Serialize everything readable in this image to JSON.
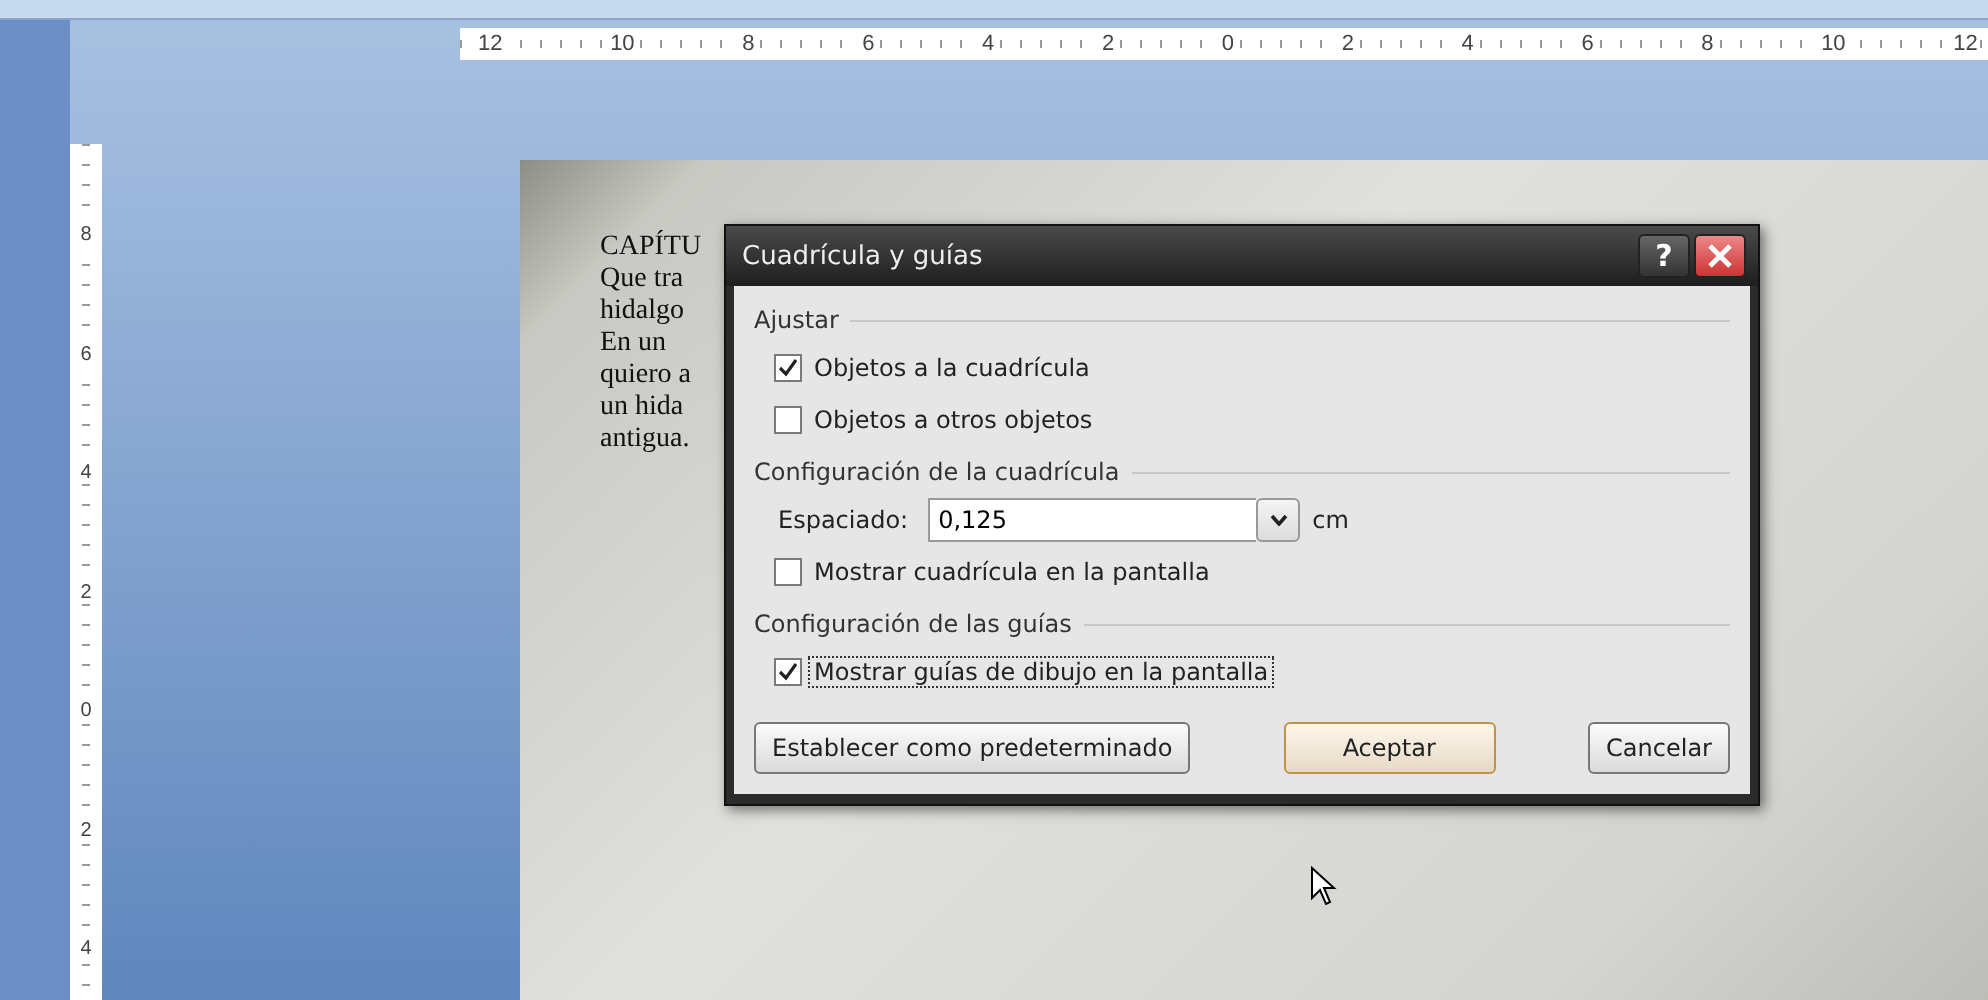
{
  "top_ruler": {
    "labels": [
      "12",
      "10",
      "8",
      "6",
      "4",
      "2",
      "0",
      "2",
      "4",
      "6",
      "8",
      "10",
      "12"
    ]
  },
  "side_ruler": {
    "labels": [
      "8",
      "6",
      "4",
      "2",
      "0",
      "2",
      "4"
    ]
  },
  "document": {
    "lines": [
      "CAPÍTU",
      "Que tra",
      "hidalgo",
      "En un",
      "quiero a",
      "un hida",
      "antigua."
    ]
  },
  "dialog": {
    "title": "Cuadrícula y guías",
    "help": "?",
    "sections": [
      {
        "heading": "Ajustar",
        "items": [
          {
            "kind": "checkbox",
            "label": "Objetos a la cuadrícula",
            "checked": true,
            "focused": false
          },
          {
            "kind": "checkbox",
            "label": "Objetos a otros objetos",
            "checked": false,
            "focused": false
          }
        ]
      },
      {
        "heading": "Configuración de la cuadrícula",
        "items": [
          {
            "kind": "combo",
            "label": "Espaciado:",
            "value": "0,125",
            "unit": "cm"
          },
          {
            "kind": "checkbox",
            "label": "Mostrar cuadrícula en la pantalla",
            "checked": false,
            "focused": false
          }
        ]
      },
      {
        "heading": "Configuración de las guías",
        "items": [
          {
            "kind": "checkbox",
            "label": "Mostrar guías de dibujo en la pantalla",
            "checked": true,
            "focused": true
          }
        ]
      }
    ],
    "buttons": [
      {
        "label": "Establecer como predeterminado",
        "default": false
      },
      {
        "label": "Aceptar",
        "default": true
      },
      {
        "label": "Cancelar",
        "default": false
      }
    ]
  }
}
